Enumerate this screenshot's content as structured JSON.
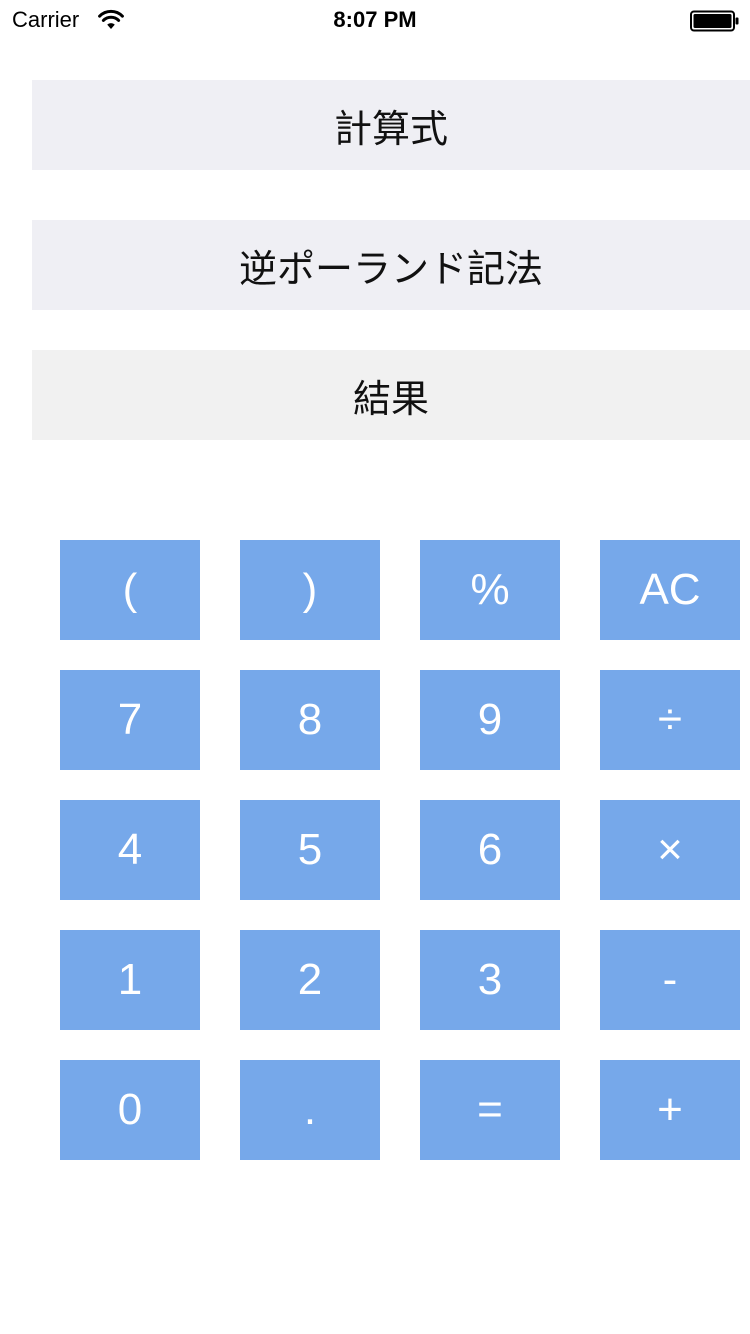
{
  "status_bar": {
    "carrier": "Carrier",
    "time": "8:07 PM",
    "wifi_icon": "wifi-icon",
    "battery_icon": "battery-icon"
  },
  "displays": {
    "formula": "計算式",
    "rpn": "逆ポーランド記法",
    "result": "結果"
  },
  "keypad": {
    "rows": [
      [
        "(",
        ")",
        "%",
        "AC"
      ],
      [
        "7",
        "8",
        "9",
        "÷"
      ],
      [
        "4",
        "5",
        "6",
        "×"
      ],
      [
        "1",
        "2",
        "3",
        "-"
      ],
      [
        "0",
        ".",
        "=",
        "+"
      ]
    ]
  },
  "colors": {
    "key_background": "#76a8ea",
    "key_text": "#ffffff",
    "display_background": "#efeff4",
    "result_background": "#f1f1f1"
  }
}
